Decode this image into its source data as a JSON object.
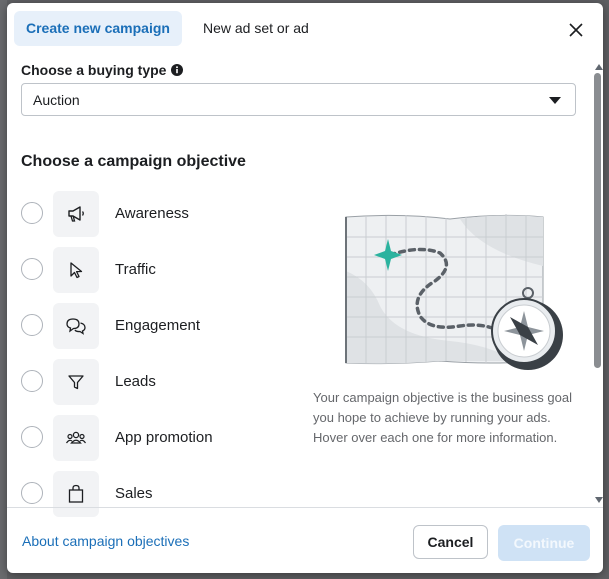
{
  "tabs": {
    "create": "Create new campaign",
    "other": "New ad set or ad"
  },
  "buying": {
    "label": "Choose a buying type",
    "value": "Auction"
  },
  "objectives": {
    "heading": "Choose a campaign objective",
    "items": [
      {
        "label": "Awareness",
        "icon": "megaphone-icon"
      },
      {
        "label": "Traffic",
        "icon": "cursor-icon"
      },
      {
        "label": "Engagement",
        "icon": "chat-bubbles-icon"
      },
      {
        "label": "Leads",
        "icon": "funnel-icon"
      },
      {
        "label": "App promotion",
        "icon": "people-icon"
      },
      {
        "label": "Sales",
        "icon": "shopping-bag-icon"
      }
    ]
  },
  "description": "Your campaign objective is the business goal you hope to achieve by running your ads. Hover over each one for more information.",
  "footer": {
    "link": "About campaign objectives",
    "cancel": "Cancel",
    "continue": "Continue"
  },
  "colors": {
    "accent": "#1b6fb8",
    "tab_bg": "#e7f0fa",
    "continue_disabled": "#cfe2f5"
  }
}
